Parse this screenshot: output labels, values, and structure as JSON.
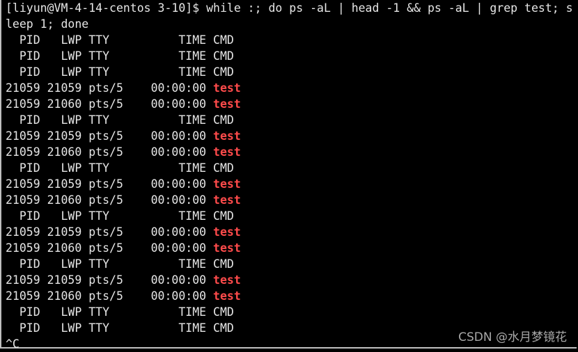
{
  "terminal": {
    "lines": [
      {
        "text": "[liyun@VM-4-14-centos 3-10]$ while :; do ps -aL | head -1 && ps -aL | grep test; s",
        "highlight": ""
      },
      {
        "text": "leep 1; done",
        "highlight": ""
      },
      {
        "text": "  PID   LWP TTY          TIME CMD",
        "highlight": ""
      },
      {
        "text": "  PID   LWP TTY          TIME CMD",
        "highlight": ""
      },
      {
        "text": "  PID   LWP TTY          TIME CMD",
        "highlight": ""
      },
      {
        "text": "21059 21059 pts/5    00:00:00 ",
        "highlight": "test"
      },
      {
        "text": "21059 21060 pts/5    00:00:00 ",
        "highlight": "test"
      },
      {
        "text": "  PID   LWP TTY          TIME CMD",
        "highlight": ""
      },
      {
        "text": "21059 21059 pts/5    00:00:00 ",
        "highlight": "test"
      },
      {
        "text": "21059 21060 pts/5    00:00:00 ",
        "highlight": "test"
      },
      {
        "text": "  PID   LWP TTY          TIME CMD",
        "highlight": ""
      },
      {
        "text": "21059 21059 pts/5    00:00:00 ",
        "highlight": "test"
      },
      {
        "text": "21059 21060 pts/5    00:00:00 ",
        "highlight": "test"
      },
      {
        "text": "  PID   LWP TTY          TIME CMD",
        "highlight": ""
      },
      {
        "text": "21059 21059 pts/5    00:00:00 ",
        "highlight": "test"
      },
      {
        "text": "21059 21060 pts/5    00:00:00 ",
        "highlight": "test"
      },
      {
        "text": "  PID   LWP TTY          TIME CMD",
        "highlight": ""
      },
      {
        "text": "21059 21059 pts/5    00:00:00 ",
        "highlight": "test"
      },
      {
        "text": "21059 21060 pts/5    00:00:00 ",
        "highlight": "test"
      },
      {
        "text": "  PID   LWP TTY          TIME CMD",
        "highlight": ""
      },
      {
        "text": "  PID   LWP TTY          TIME CMD",
        "highlight": ""
      },
      {
        "text": "^C",
        "highlight": ""
      }
    ],
    "colors": {
      "background": "#000000",
      "text": "#e6e6e6",
      "match": "#ff4b4b"
    }
  },
  "watermark": "CSDN @水月梦镜花"
}
